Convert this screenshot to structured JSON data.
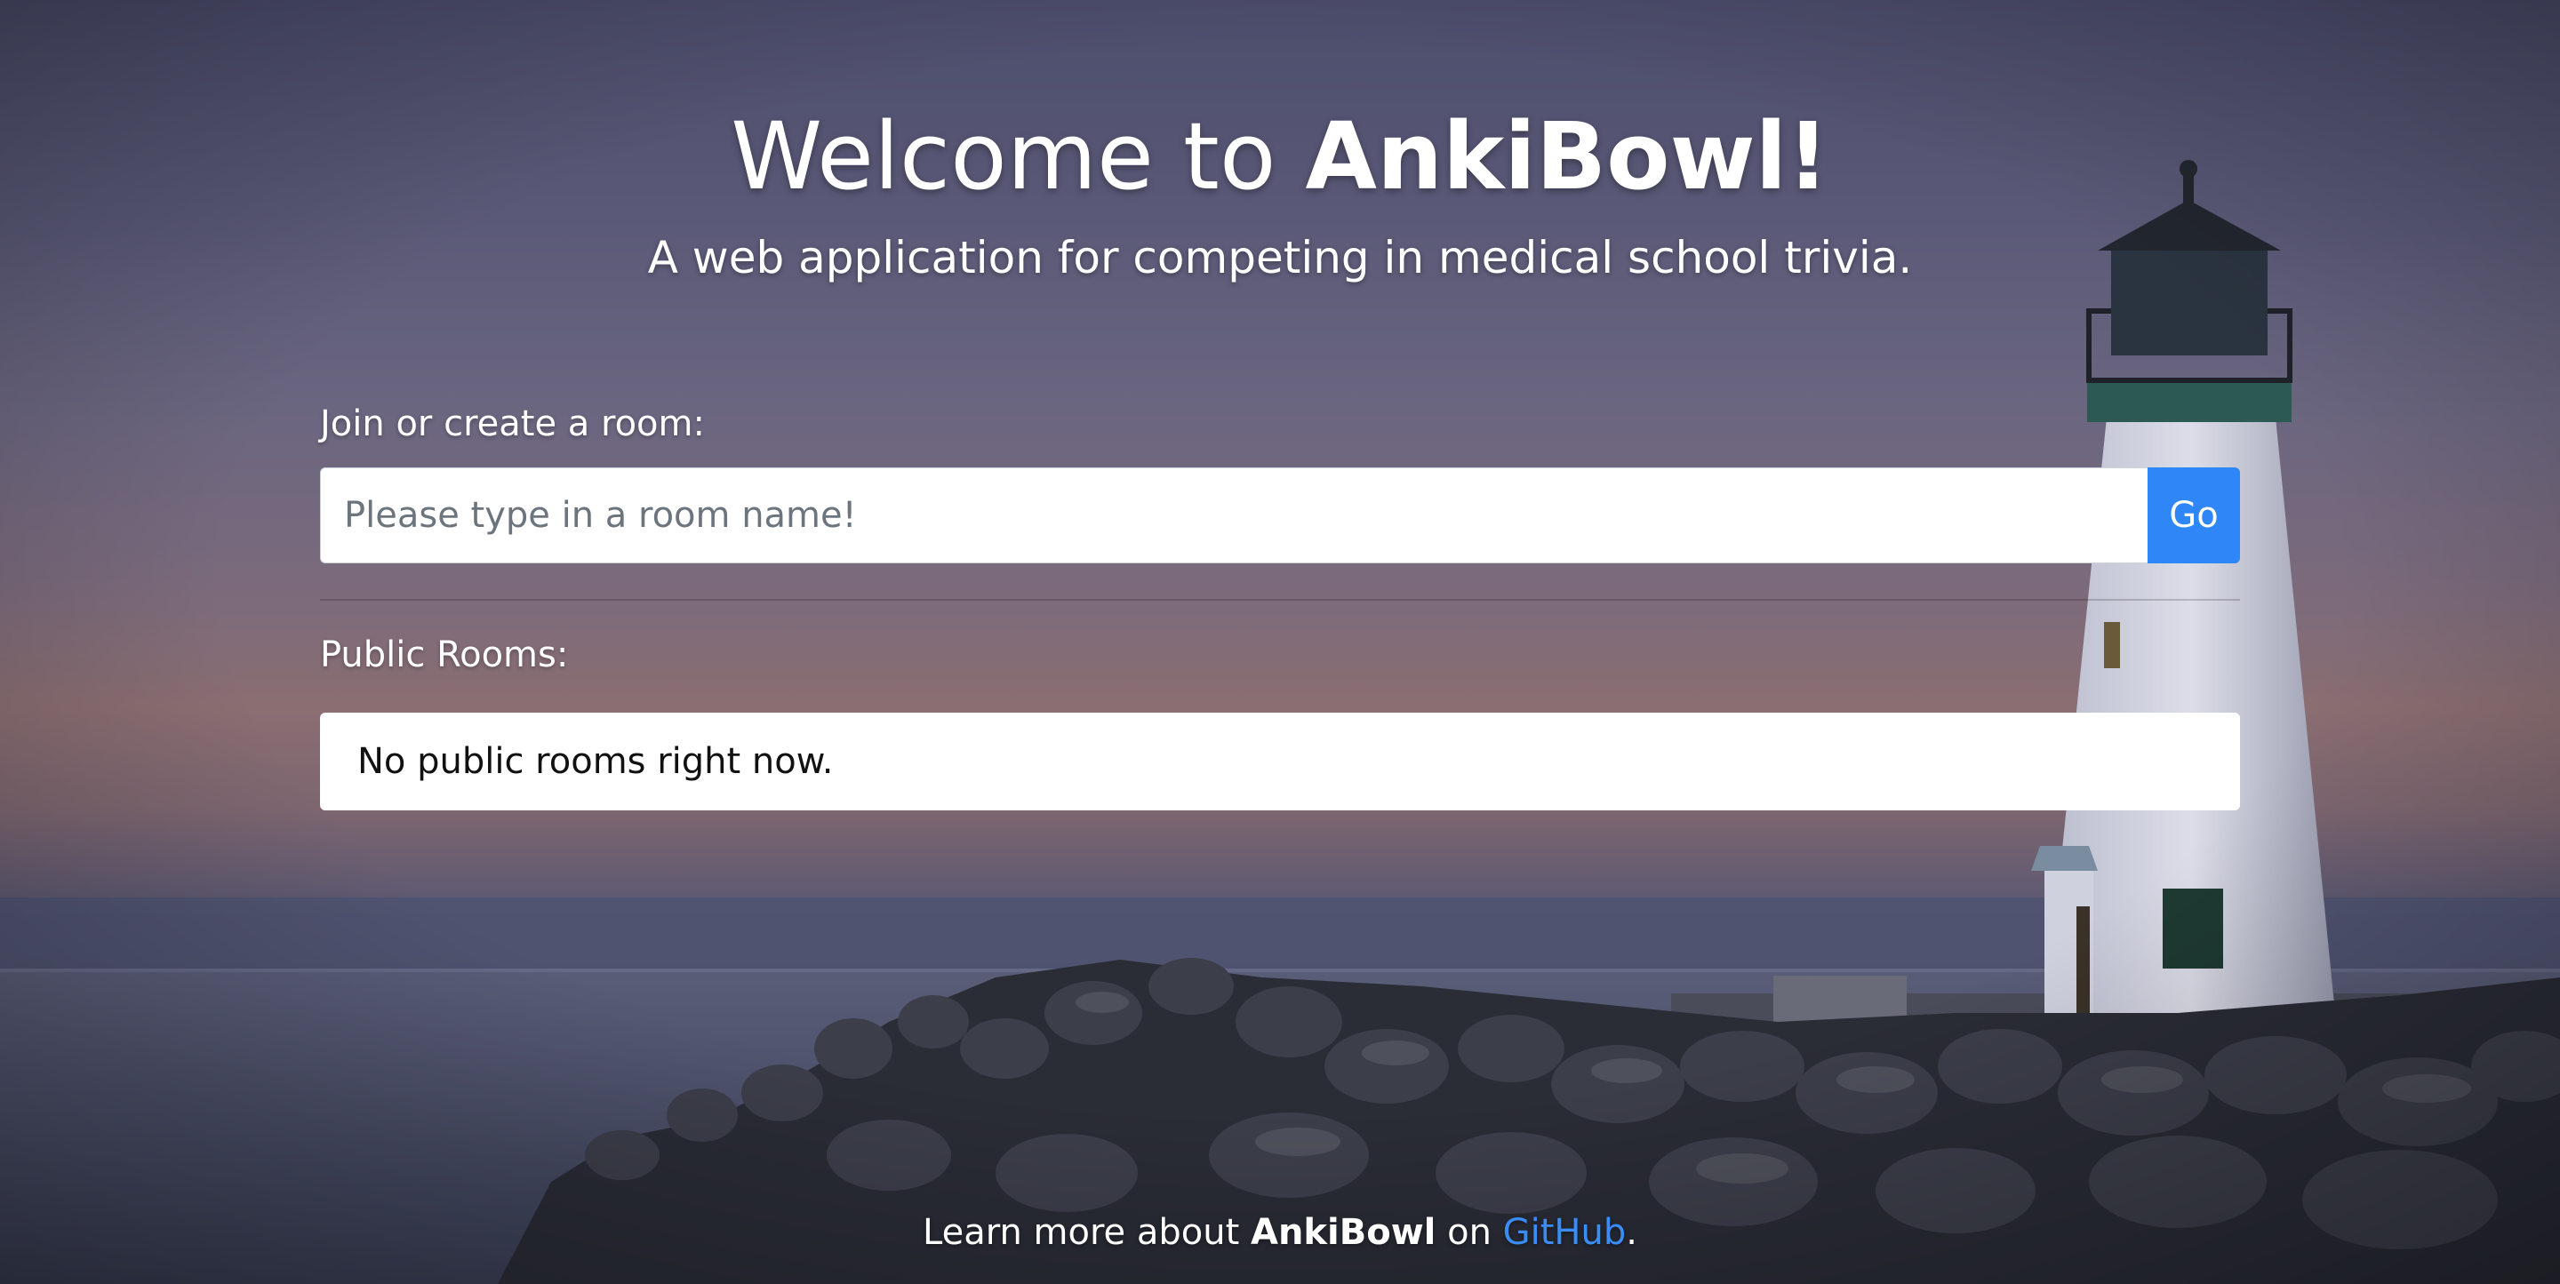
{
  "header": {
    "title_prefix": "Welcome to ",
    "title_brand": "AnkiBowl!",
    "subtitle": "A web application for competing in medical school trivia."
  },
  "join": {
    "label": "Join or create a room:",
    "placeholder": "Please type in a room name!",
    "value": "",
    "button_label": "Go"
  },
  "public_rooms": {
    "label": "Public Rooms:",
    "empty_message": "No public rooms right now."
  },
  "footer": {
    "prefix": "Learn more about ",
    "brand": "AnkiBowl",
    "middle": " on ",
    "link_text": "GitHub",
    "suffix": "."
  },
  "colors": {
    "accent": "#2f86f6",
    "link": "#3b8df5",
    "panel": "#ffffff"
  },
  "background": {
    "description_icon": "lighthouse-seascape"
  }
}
